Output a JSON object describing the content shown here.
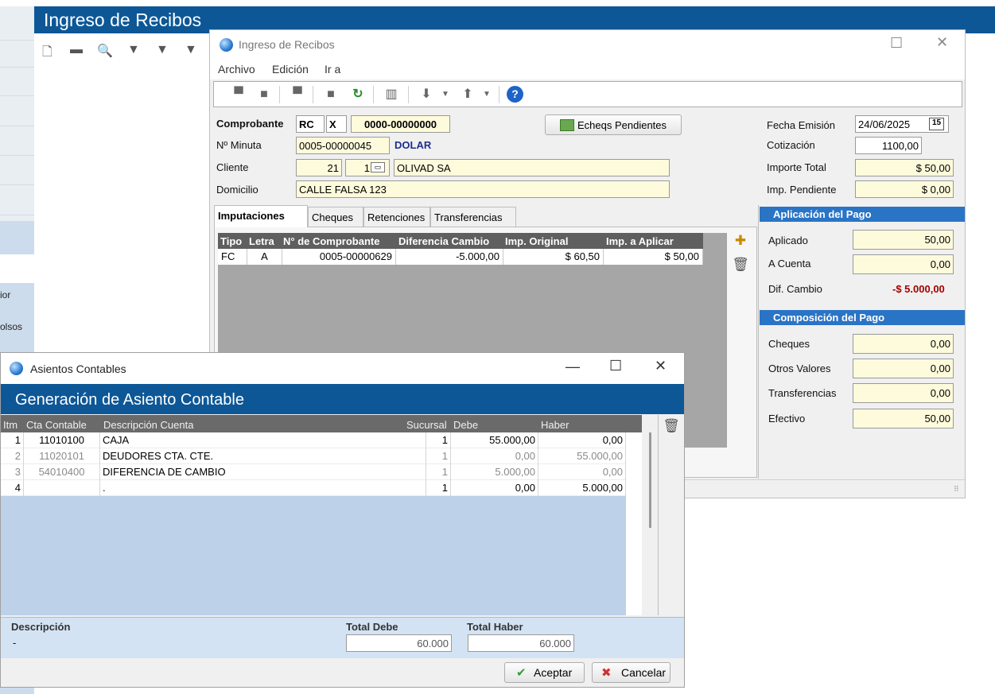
{
  "background_app": {
    "title": "Ingreso de Recibos",
    "left_labels": [
      "ior",
      "olsos"
    ],
    "toolbar_icons": [
      "new-doc-icon",
      "print-icon",
      "search-icon",
      "filter-icon",
      "filter-add-icon",
      "filter-remove-icon"
    ]
  },
  "receipt_window": {
    "title": "Ingreso de Recibos",
    "menu": [
      "Archivo",
      "Edición",
      "Ir a"
    ],
    "toolbar_icons": [
      "save-icon",
      "stop-icon",
      "print-icon",
      "stop-icon",
      "refresh-icon",
      "delete-icon",
      "arrow-down-icon",
      "arrow-up-icon",
      "help-icon"
    ],
    "comprobante": {
      "label": "Comprobante",
      "tipo": "RC",
      "letra": "X",
      "numero": "0000-00000000"
    },
    "minuta": {
      "label": "Nº Minuta",
      "value": "0005-00000045",
      "moneda": "DOLAR"
    },
    "cliente": {
      "label": "Cliente",
      "codigo": "21",
      "sucursal": "1",
      "nombre": "OLIVAD SA"
    },
    "domicilio": {
      "label": "Domicilio",
      "value": "CALLE FALSA 123"
    },
    "echeqs_button": "Echeqs Pendientes",
    "fecha_emision": {
      "label": "Fecha Emisión",
      "value": "24/06/2025",
      "calendar": "15"
    },
    "cotizacion": {
      "label": "Cotización",
      "value": "1100,00"
    },
    "importe_total": {
      "label": "Importe Total",
      "value": "$ 50,00"
    },
    "imp_pendiente": {
      "label": "Imp. Pendiente",
      "value": "$ 0,00"
    },
    "tabs": [
      "Imputaciones",
      "Cheques",
      "Retenciones",
      "Transferencias"
    ],
    "imputaciones": {
      "columns": [
        "Tipo",
        "Letra",
        "N° de Comprobante",
        "Diferencia Cambio",
        "Imp. Original",
        "Imp. a Aplicar"
      ],
      "rows": [
        {
          "tipo": "FC",
          "letra": "A",
          "comprobante": "0005-00000629",
          "dif_cambio": "-5.000,00",
          "imp_original": "$ 60,50",
          "imp_aplicar": "$ 50,00"
        }
      ]
    },
    "aplicacion": {
      "title": "Aplicación del Pago",
      "aplicado": {
        "label": "Aplicado",
        "value": "50,00"
      },
      "a_cuenta": {
        "label": "A Cuenta",
        "value": "0,00"
      },
      "dif_cambio": {
        "label": "Dif. Cambio",
        "value": "-$ 5.000,00"
      }
    },
    "composicion": {
      "title": "Composición del Pago",
      "cheques": {
        "label": "Cheques",
        "value": "0,00"
      },
      "otros": {
        "label": "Otros Valores",
        "value": "0,00"
      },
      "transferencias": {
        "label": "Transferencias",
        "value": "0,00"
      },
      "efectivo": {
        "label": "Efectivo",
        "value": "50,00"
      }
    }
  },
  "asientos_window": {
    "title": "Asientos Contables",
    "banner": "Generación de Asiento Contable",
    "columns": [
      "Itm",
      "Cta Contable",
      "Descripción Cuenta",
      "Sucursal",
      "Debe",
      "Haber"
    ],
    "rows": [
      {
        "itm": "1",
        "cuenta": "11010100",
        "descripcion": "CAJA",
        "sucursal": "1",
        "debe": "55.000,00",
        "haber": "0,00"
      },
      {
        "itm": "2",
        "cuenta": "11020101",
        "descripcion": "DEUDORES CTA. CTE.",
        "sucursal": "1",
        "debe": "0,00",
        "haber": "55.000,00"
      },
      {
        "itm": "3",
        "cuenta": "54010400",
        "descripcion": "DIFERENCIA DE CAMBIO",
        "sucursal": "1",
        "debe": "5.000,00",
        "haber": "0,00"
      },
      {
        "itm": "4",
        "cuenta": "",
        "descripcion": ".",
        "sucursal": "1",
        "debe": "0,00",
        "haber": "5.000,00"
      }
    ],
    "descripcion_label": "Descripción",
    "descripcion_value": "-",
    "total_debe_label": "Total Debe",
    "total_debe": "60.000",
    "total_haber_label": "Total Haber",
    "total_haber": "60.000",
    "accept_label": "Aceptar",
    "cancel_label": "Cancelar"
  }
}
